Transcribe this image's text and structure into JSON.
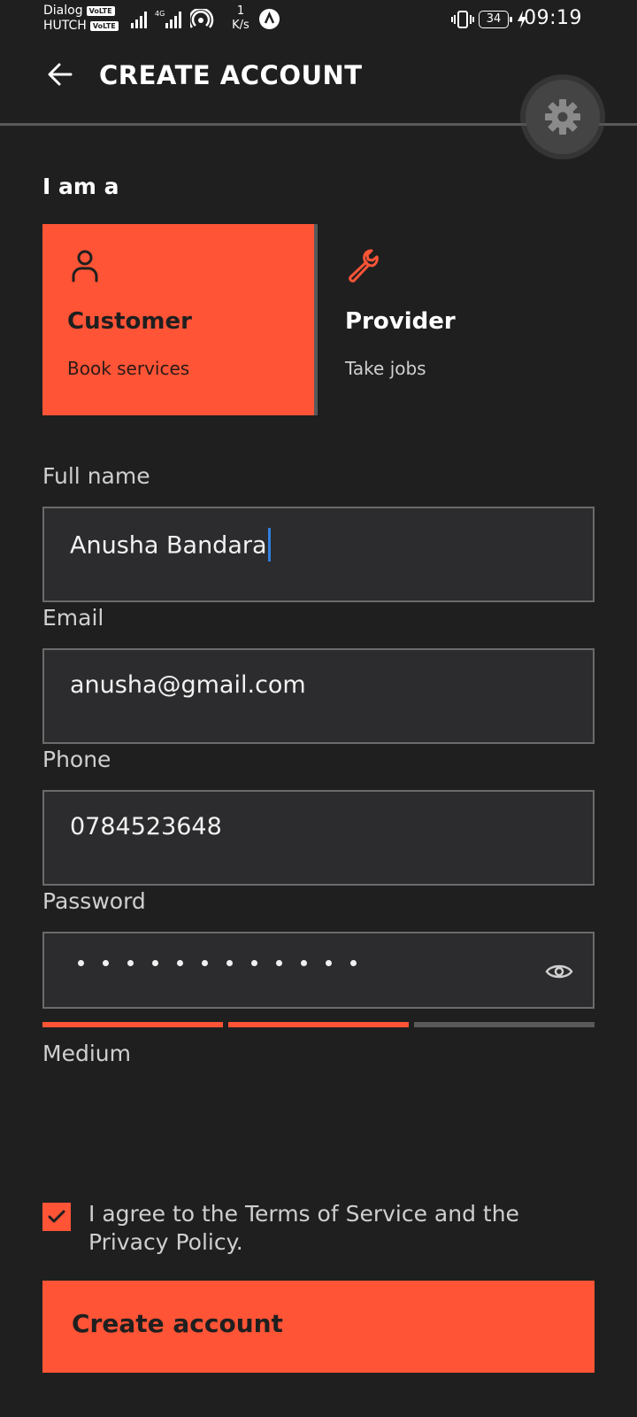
{
  "status_bar": {
    "carrier_1": "Dialog",
    "carrier_2": "HUTCH",
    "volte_label": "VoLTE",
    "network_type": "4G",
    "net_speed_value": "1",
    "net_speed_unit": "K/s",
    "battery_level": "34",
    "time": "09:19"
  },
  "app_bar": {
    "title": "CREATE ACCOUNT",
    "back_icon": "arrow-left-icon",
    "settings_icon": "gear-icon"
  },
  "role": {
    "label": "I am a",
    "options": [
      {
        "title": "Customer",
        "subtitle": "Book services",
        "icon": "person-icon",
        "selected": true
      },
      {
        "title": "Provider",
        "subtitle": "Take jobs",
        "icon": "wrench-icon",
        "selected": false
      }
    ]
  },
  "form": {
    "full_name": {
      "label": "Full name",
      "value": "Anusha Bandara"
    },
    "email": {
      "label": "Email",
      "value": "anusha@gmail.com"
    },
    "phone": {
      "label": "Phone",
      "value": "0784523648"
    },
    "password": {
      "label": "Password",
      "masked_length": 12,
      "toggle_icon": "eye-icon"
    },
    "strength": {
      "label": "Medium",
      "filled_segments": 2,
      "total_segments": 3
    }
  },
  "agreement": {
    "checked": true,
    "text": "I agree to the Terms of Service and the Privacy Policy."
  },
  "submit": {
    "label": "Create account"
  },
  "colors": {
    "accent": "#ff5436",
    "background": "#1f1f1f",
    "field_background": "#2c2b2d",
    "field_border": "#6b6b6b",
    "strength_empty": "#5a5a5a"
  }
}
